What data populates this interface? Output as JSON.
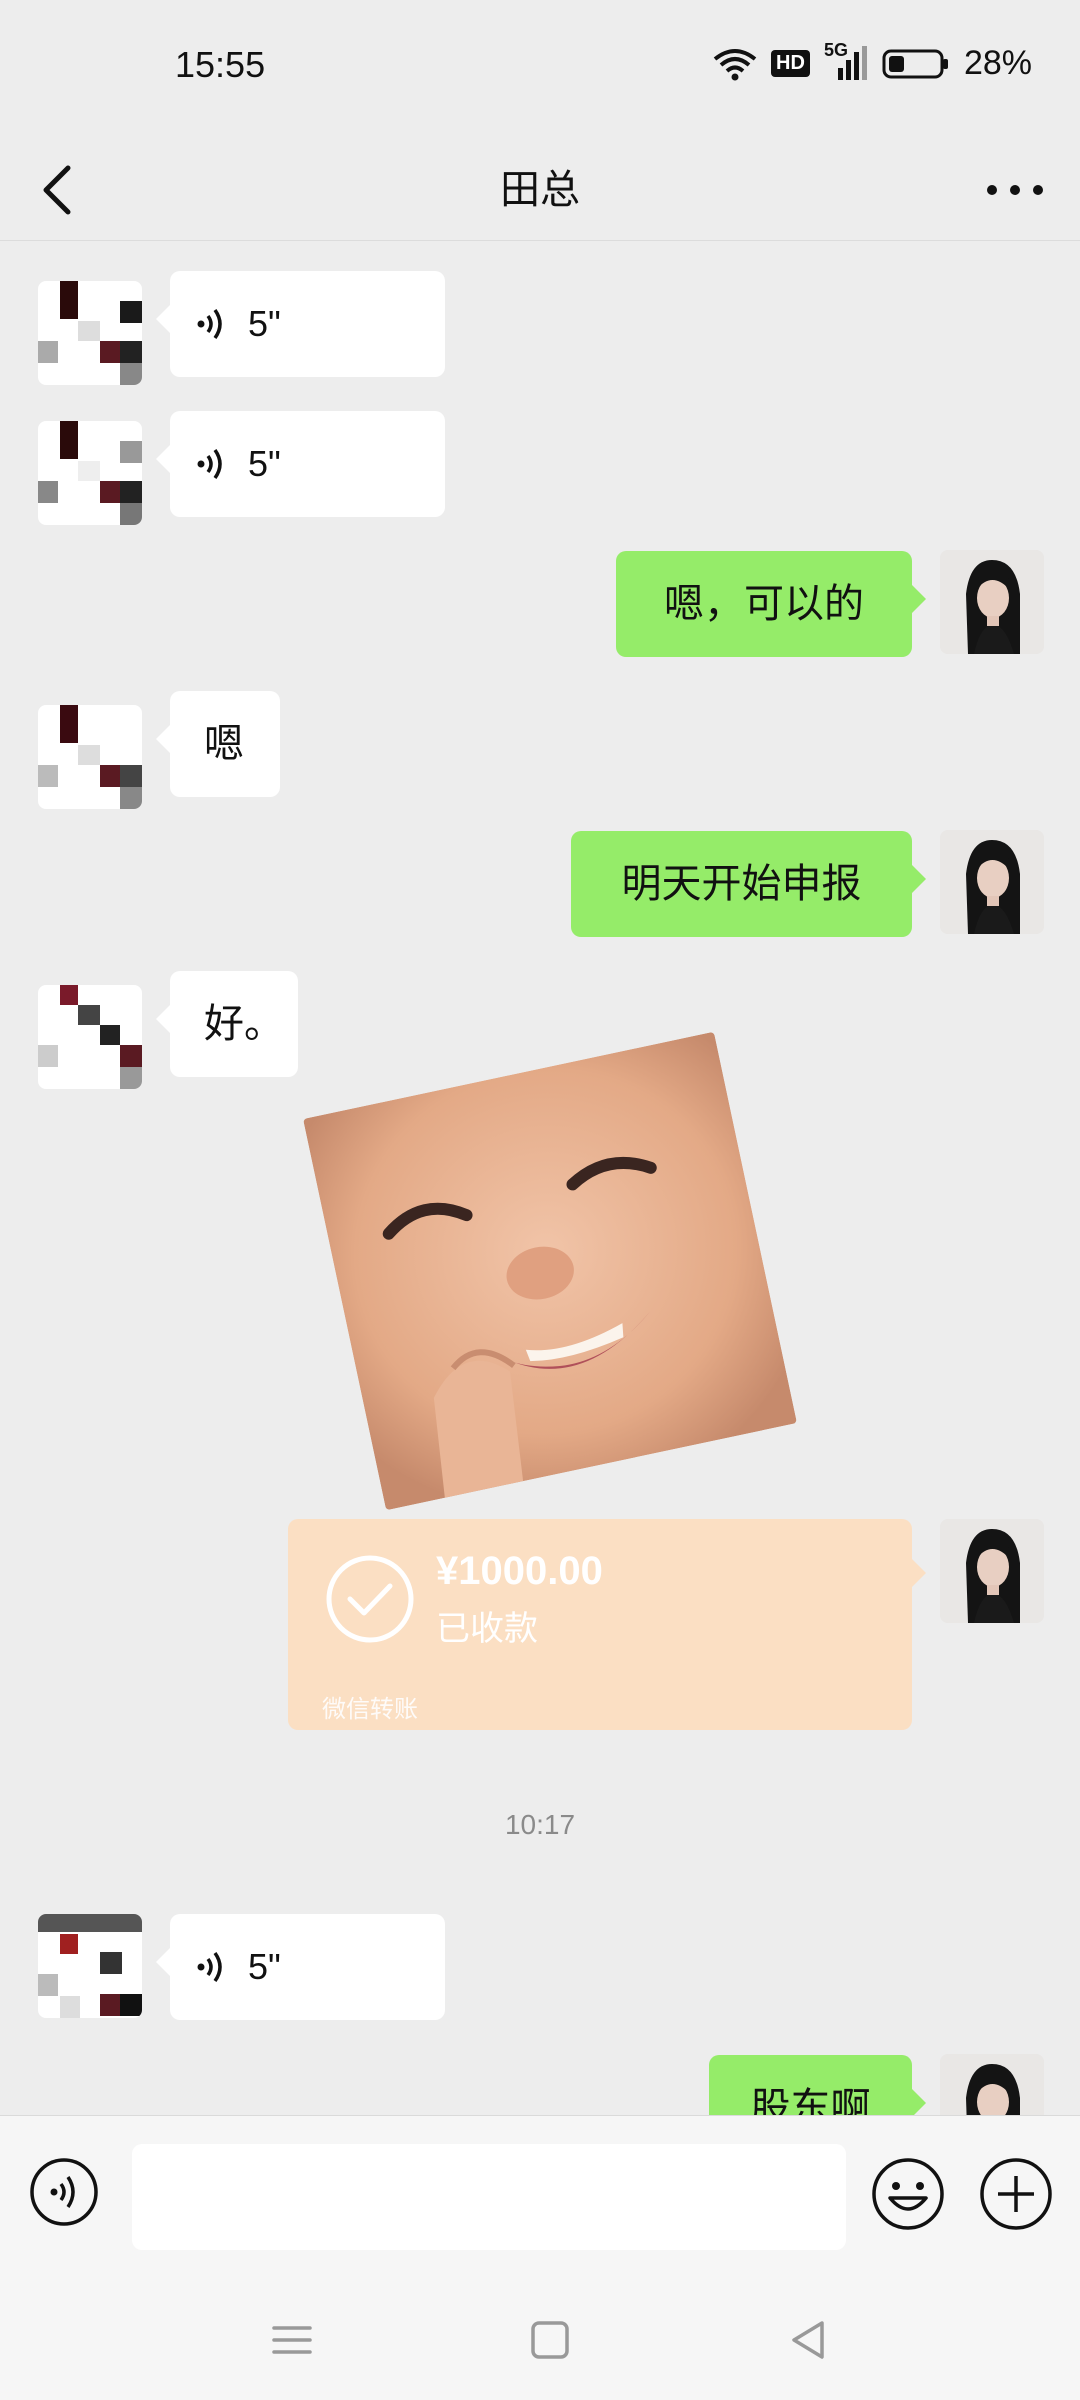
{
  "status_bar": {
    "time": "15:55",
    "hd": "HD",
    "network": "5G",
    "battery": "28%"
  },
  "nav": {
    "title": "田总"
  },
  "messages": {
    "m1_duration": "5\"",
    "m2_duration": "5\"",
    "m3_text": "嗯，可以的",
    "m4_text": "嗯",
    "m5_text": "明天开始申报",
    "m6_text": "好。",
    "transfer": {
      "amount": "¥1000.00",
      "status": "已收款",
      "label": "微信转账"
    },
    "time_separator": "10:17",
    "m9_duration": "5\"",
    "m10_text": "股东啊"
  },
  "input_bar": {
    "placeholder": ""
  },
  "colors": {
    "outgoing_bubble": "#95ec69",
    "incoming_bubble": "#ffffff",
    "transfer_card": "#fbdfc3",
    "background": "#ededed"
  },
  "icons": [
    "back-arrow-icon",
    "more-icon",
    "voice-wave-icon",
    "emoji-icon",
    "plus-icon",
    "check-circle-icon",
    "wifi-icon",
    "signal-icon",
    "battery-icon"
  ]
}
